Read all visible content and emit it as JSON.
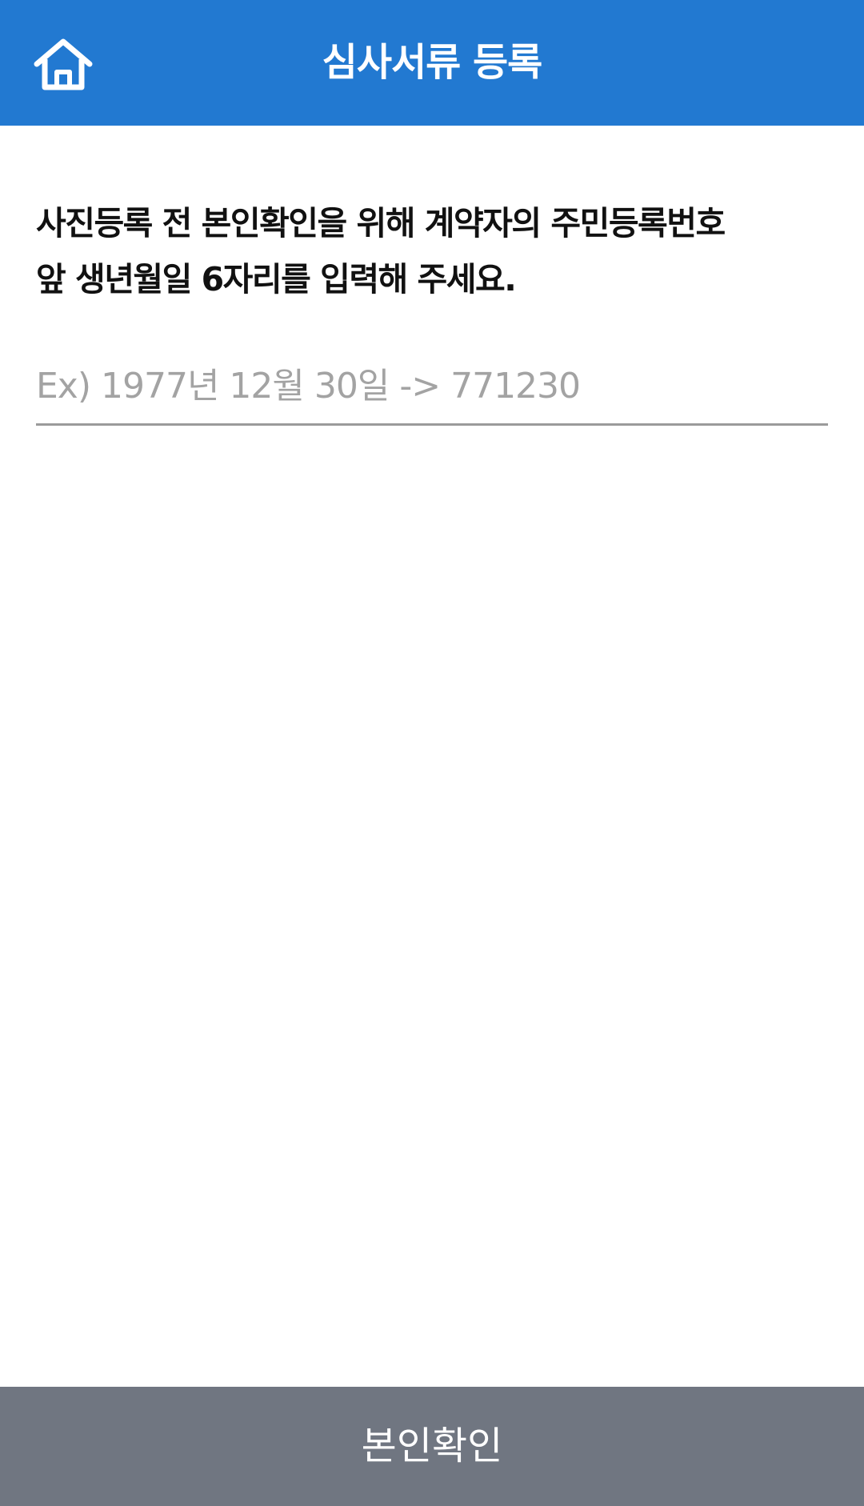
{
  "header": {
    "title": "심사서류 등록",
    "home_icon": "home-icon",
    "background_color": "#2279d1"
  },
  "instruction": {
    "line1": "사진등록 전 본인확인을 위해 계약자의 주민등록번호",
    "line2": "앞 생년월일 6자리를 입력해 주세요."
  },
  "birth_input": {
    "value": "",
    "placeholder": "Ex) 1977년 12월 30일 -> 771230"
  },
  "footer": {
    "confirm_label": "본인확인",
    "background_color": "#707681"
  }
}
